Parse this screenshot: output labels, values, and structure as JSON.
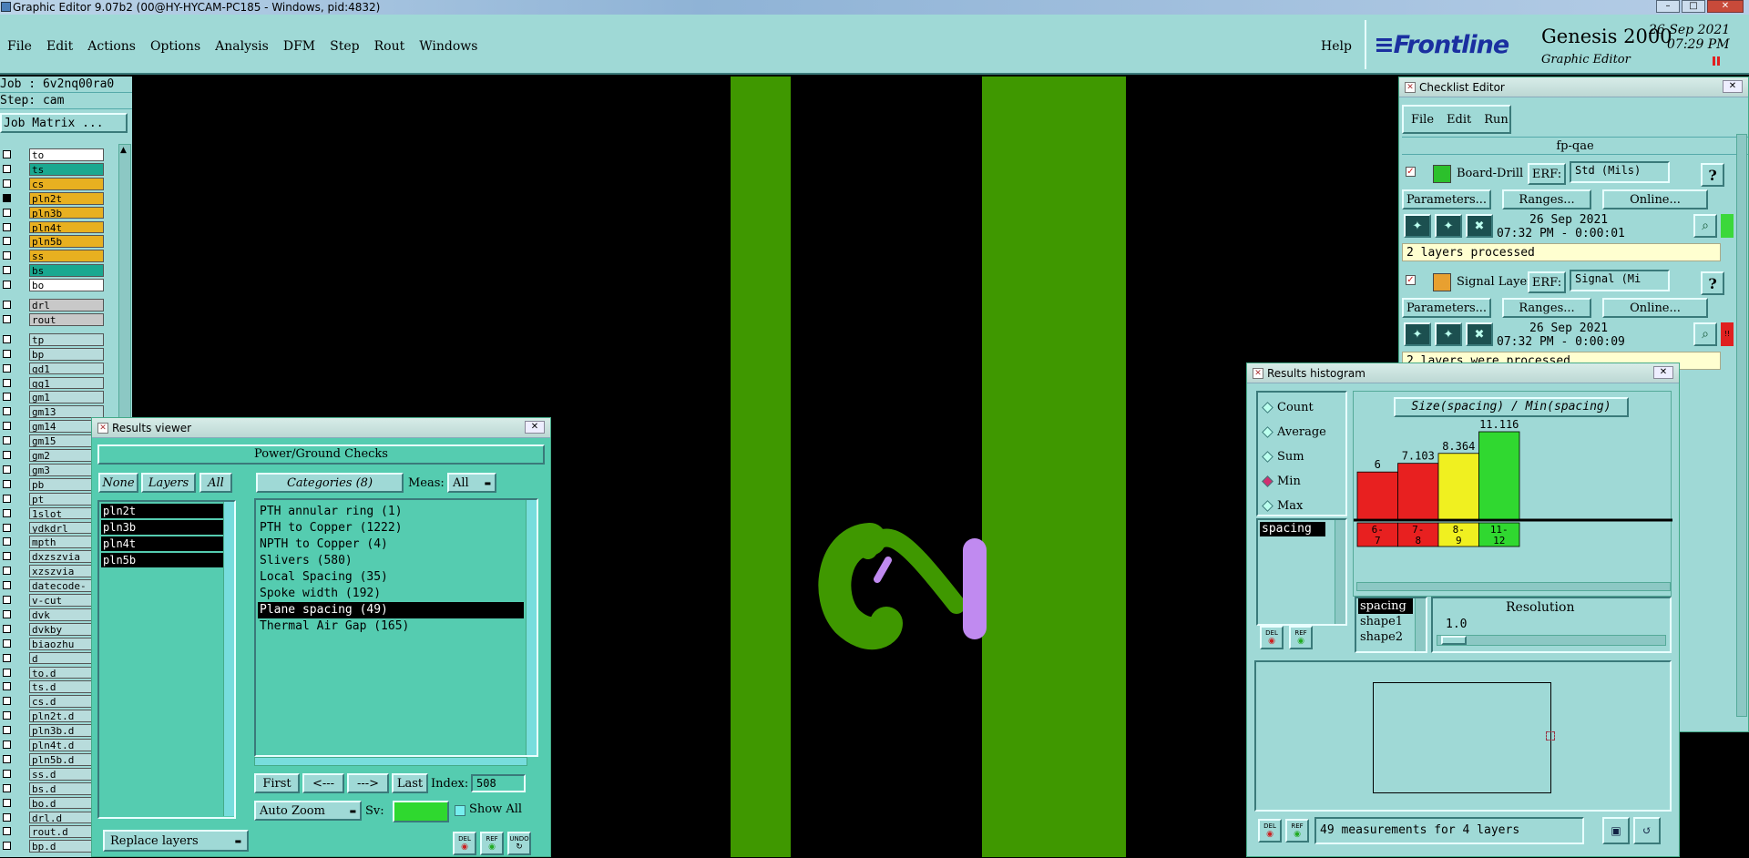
{
  "window": {
    "title": "Graphic Editor 9.07b2 (00@HY-HYCAM-PC185 - Windows, pid:4832)"
  },
  "menu": {
    "items": [
      "File",
      "Edit",
      "Actions",
      "Options",
      "Analysis",
      "DFM",
      "Step",
      "Rout",
      "Windows"
    ],
    "help": "Help"
  },
  "brand": {
    "logo": "Frontline",
    "product": "Genesis 2000",
    "subtitle": "Graphic Editor",
    "date": "26 Sep 2021",
    "time": "07:29 PM"
  },
  "job": {
    "job_label": "Job : 6v2nq00ra0",
    "step_label": "Step: cam",
    "matrix_button": "Job Matrix ..."
  },
  "layers": [
    {
      "name": "to",
      "color": "#ffffff"
    },
    {
      "name": "ts",
      "color": "#1aa890"
    },
    {
      "name": "cs",
      "color": "#e8b020"
    },
    {
      "name": "pln2t",
      "color": "#e8b020"
    },
    {
      "name": "pln3b",
      "color": "#e8b020"
    },
    {
      "name": "pln4t",
      "color": "#e8b020"
    },
    {
      "name": "pln5b",
      "color": "#e8b020"
    },
    {
      "name": "ss",
      "color": "#e8b020"
    },
    {
      "name": "bs",
      "color": "#1aa890"
    },
    {
      "name": "bo",
      "color": "#ffffff"
    }
  ],
  "drill_layers": [
    "drl",
    "rout"
  ],
  "misc_layers": [
    "tp",
    "bp",
    "gd1",
    "gg1",
    "gm1",
    "gm13",
    "gm14",
    "gm15",
    "gm2",
    "gm3",
    "pb",
    "pt",
    "1slot",
    "ydkdrl",
    "mpth",
    "dxzszvia",
    "xzszvia",
    "datecode-",
    "v-cut",
    "dvk",
    "dvkby",
    "biaozhu",
    "d",
    "to.d",
    "ts.d",
    "cs.d",
    "pln2t.d",
    "pln3b.d",
    "pln4t.d",
    "pln5b.d",
    "ss.d",
    "bs.d",
    "bo.d",
    "drl.d",
    "rout.d",
    "bp.d"
  ],
  "results_viewer": {
    "title": "Results viewer",
    "header": "Power/Ground Checks",
    "none": "None",
    "layers_tab": "Layers",
    "all": "All",
    "categories_label": "Categories (8)",
    "meas_label": "Meas:",
    "meas_value": "All",
    "layer_list": [
      "pln2t",
      "pln3b",
      "pln4t",
      "pln5b"
    ],
    "categories": [
      "PTH annular ring (1)",
      "PTH to Copper (1222)",
      "NPTH to Copper (4)",
      "Slivers (580)",
      "Local Spacing (35)",
      "Spoke width (192)",
      "Plane spacing (49)",
      "Thermal Air Gap (165)"
    ],
    "selected_category": "Plane spacing (49)",
    "first": "First",
    "prev": "<---",
    "next": "--->",
    "last": "Last",
    "index_label": "Index:",
    "index_value": "508",
    "zoom": "Auto Zoom",
    "sv_label": "Sv:",
    "show_all": "Show All",
    "replace": "Replace layers",
    "icons": [
      "DEL",
      "REF",
      "UNDO"
    ]
  },
  "checklist": {
    "title": "Checklist Editor",
    "menu": [
      "File",
      "Edit",
      "Run"
    ],
    "name": "fp-qae",
    "checks": [
      {
        "name": "Board-Drill Che",
        "erf_label": "ERF:",
        "erf_value": "Std (Mils)",
        "params": "Parameters...",
        "ranges": "Ranges...",
        "online": "Online...",
        "date": "26 Sep 2021",
        "time": "07:32 PM - 0:00:01",
        "status": "2 layers processed",
        "status_color": "#3bd83b"
      },
      {
        "name": "Signal Layer Ch",
        "erf_label": "ERF:",
        "erf_value": "Signal (Mi",
        "params": "Parameters...",
        "ranges": "Ranges...",
        "online": "Online...",
        "date": "26 Sep 2021",
        "time": "07:32 PM - 0:00:09",
        "status": "2 layers were processed",
        "status_color": "#e02020"
      }
    ],
    "help_glyph": "?",
    "bar_marker": "!!"
  },
  "histogram": {
    "title": "Results histogram",
    "modes": [
      "Count",
      "Average",
      "Sum",
      "Min",
      "Max"
    ],
    "selected_mode": "Min",
    "field_list": [
      "spacing"
    ],
    "chart_title": "Size(spacing) / Min(spacing)",
    "icons": [
      "DEL",
      "REF"
    ],
    "res_list": [
      "spacing",
      "shape1",
      "shape2"
    ],
    "resolution_label": "Resolution",
    "resolution_value": "1.0",
    "status": "49 measurements for 4 layers"
  },
  "chart_data": {
    "type": "bar",
    "title": "Size(spacing) / Min(spacing)",
    "categories": [
      "6-7",
      "7-8",
      "8-9",
      "11-12"
    ],
    "category_labels": [
      [
        "6-",
        "7"
      ],
      [
        "7-",
        "8"
      ],
      [
        "8-",
        "9"
      ],
      [
        "11-",
        "12"
      ]
    ],
    "values": [
      6,
      7.103,
      8.364,
      11.116
    ],
    "value_labels": [
      "6",
      "7.103",
      "8.364",
      "11.116"
    ],
    "colors": [
      "#e82020",
      "#e82020",
      "#f0f020",
      "#30d830"
    ],
    "ylim": [
      0,
      11.116
    ]
  }
}
